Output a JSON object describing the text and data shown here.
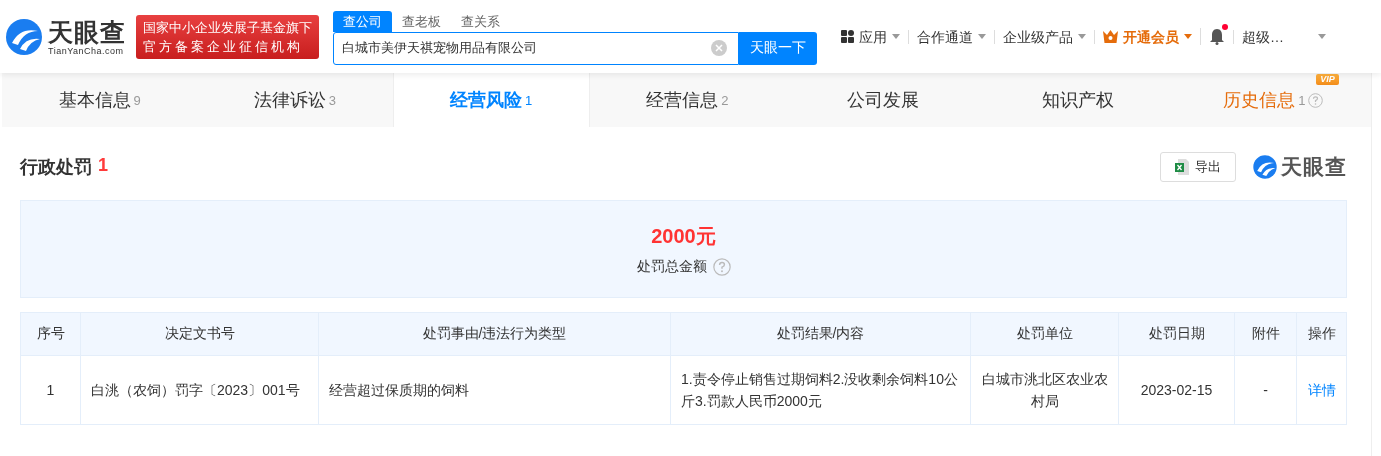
{
  "header": {
    "logo_text": "天眼查",
    "logo_domain": "TianYanCha.com",
    "banner_lines": [
      "国家中小企业发展子基金旗下",
      "官方备案企业征信机构"
    ],
    "search_tabs": [
      {
        "label": "查公司",
        "selected": true
      },
      {
        "label": "查老板",
        "selected": false
      },
      {
        "label": "查关系",
        "selected": false
      }
    ],
    "search": {
      "value": "白城市美伊天祺宠物用品有限公司",
      "button": "天眼一下"
    },
    "nav": [
      {
        "kind": "apps",
        "label": "应用"
      },
      {
        "kind": "plain",
        "label": "合作通道"
      },
      {
        "kind": "plain",
        "label": "企业级产品"
      },
      {
        "kind": "vip",
        "label": "开通会员"
      },
      {
        "kind": "bell",
        "unread": true
      },
      {
        "kind": "user",
        "label": "超级…"
      }
    ]
  },
  "tabs": [
    {
      "label": "基本信息",
      "count": "9",
      "selected": false
    },
    {
      "label": "法律诉讼",
      "count": "3",
      "selected": false
    },
    {
      "label": "经营风险",
      "count": "1",
      "selected": true
    },
    {
      "label": "经营信息",
      "count": "2",
      "selected": false
    },
    {
      "label": "公司发展",
      "selected": false
    },
    {
      "label": "知识产权",
      "selected": false
    },
    {
      "label": "历史信息",
      "count": "1",
      "selected": false,
      "badge": "VIP",
      "help": true
    }
  ],
  "section": {
    "title": "行政处罚",
    "count": "1",
    "export": "导出",
    "logo_text": "天眼查",
    "summary": {
      "amount": "2000元",
      "label": "处罚总金额"
    },
    "table": {
      "columns": [
        "序号",
        "决定文书号",
        "处罚事由/违法行为类型",
        "处罚结果/内容",
        "处罚单位",
        "处罚日期",
        "附件",
        "操作"
      ],
      "rows": [
        [
          "1",
          "白洮（农饲）罚字〔2023〕001号",
          "经营超过保质期的饲料",
          "1.责令停止销售过期饲料2.没收剩余饲料10公斤3.罚款人民币2000元",
          "白城市洮北区农业农村局",
          "2023-02-15",
          "-",
          "详情"
        ]
      ]
    }
  }
}
